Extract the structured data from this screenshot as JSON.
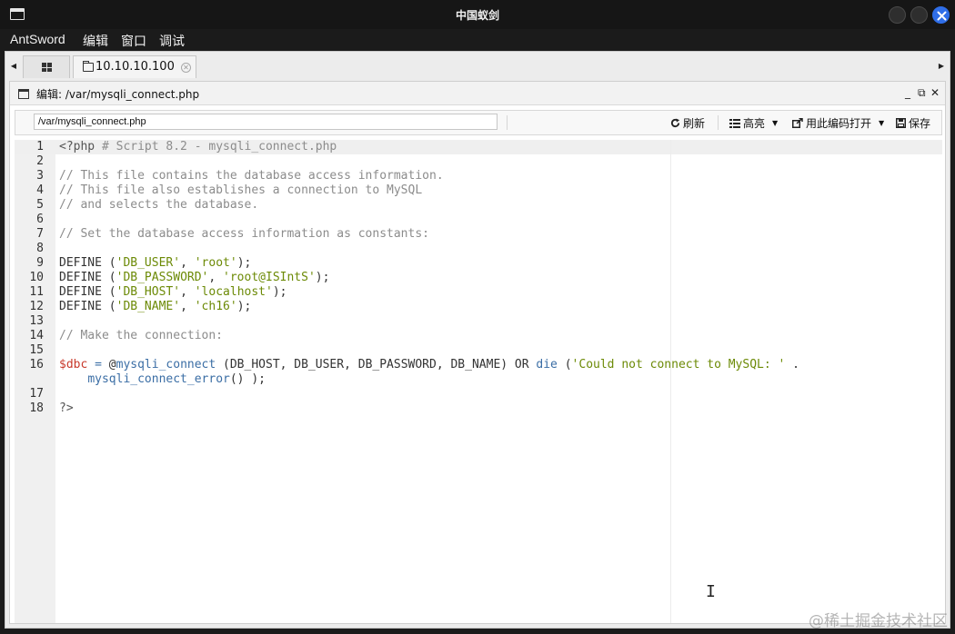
{
  "window": {
    "title": "中国蚁剑"
  },
  "menu": {
    "items": [
      "AntSword",
      "编辑",
      "窗口",
      "调试"
    ]
  },
  "tabs": {
    "home_icon": "grid-icon",
    "shell_tab_label": "10.10.10.100"
  },
  "panel": {
    "title": "编辑: /var/mysqli_connect.php",
    "controls": [
      "_",
      "⧉",
      "✕"
    ]
  },
  "toolbar": {
    "path_value": "/var/mysqli_connect.php",
    "refresh_label": "刷新",
    "highlight_label": "高亮",
    "open_with_encoding_label": "用此编码打开",
    "save_label": "保存"
  },
  "editor": {
    "lines": [
      {
        "n": "1",
        "t": "<?php # Script 8.2 - mysqli_connect.php"
      },
      {
        "n": "2",
        "t": ""
      },
      {
        "n": "3",
        "t": "// This file contains the database access information."
      },
      {
        "n": "4",
        "t": "// This file also establishes a connection to MySQL"
      },
      {
        "n": "5",
        "t": "// and selects the database."
      },
      {
        "n": "6",
        "t": ""
      },
      {
        "n": "7",
        "t": "// Set the database access information as constants:"
      },
      {
        "n": "8",
        "t": ""
      },
      {
        "n": "9",
        "t": "DEFINE ('DB_USER', 'root');"
      },
      {
        "n": "10",
        "t": "DEFINE ('DB_PASSWORD', 'root@ISIntS');"
      },
      {
        "n": "11",
        "t": "DEFINE ('DB_HOST', 'localhost');"
      },
      {
        "n": "12",
        "t": "DEFINE ('DB_NAME', 'ch16');"
      },
      {
        "n": "13",
        "t": ""
      },
      {
        "n": "14",
        "t": "// Make the connection:"
      },
      {
        "n": "15",
        "t": ""
      },
      {
        "n": "16",
        "t": "$dbc = @mysqli_connect (DB_HOST, DB_USER, DB_PASSWORD, DB_NAME) OR die ('Could not connect to MySQL: ' ."
      },
      {
        "n": "",
        "t": "    mysqli_connect_error() );"
      },
      {
        "n": "17",
        "t": ""
      },
      {
        "n": "18",
        "t": "?>"
      }
    ]
  },
  "watermark": "@稀土掘金技术社区"
}
